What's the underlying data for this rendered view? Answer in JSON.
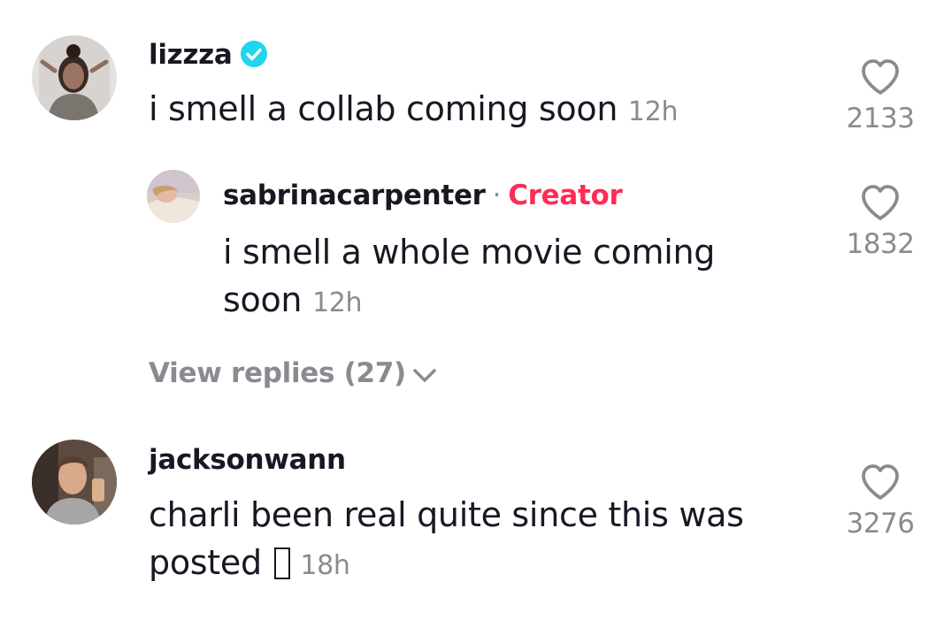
{
  "comments": [
    {
      "username": "lizzza",
      "verified": true,
      "text": "i smell a collab coming soon",
      "time": "12h",
      "likes": "2133",
      "replies": [
        {
          "username": "sabrinacarpenter",
          "separator": "·",
          "badge": "Creator",
          "text": "i smell a whole movie coming soon",
          "time": "12h",
          "likes": "1832"
        }
      ],
      "view_replies": "View replies (27)"
    },
    {
      "username": "jacksonwann",
      "text": "charli been real quite since this was posted",
      "emoji": "",
      "time": "18h",
      "likes": "3276"
    }
  ],
  "icons": {
    "like": "heart-outline-icon",
    "verified": "verified-badge-icon",
    "expand": "chevron-down-icon"
  },
  "colors": {
    "verified": "#20d5ec",
    "creator_badge": "#fe2c55",
    "muted_text": "#8a8b91",
    "primary_text": "#161823"
  }
}
